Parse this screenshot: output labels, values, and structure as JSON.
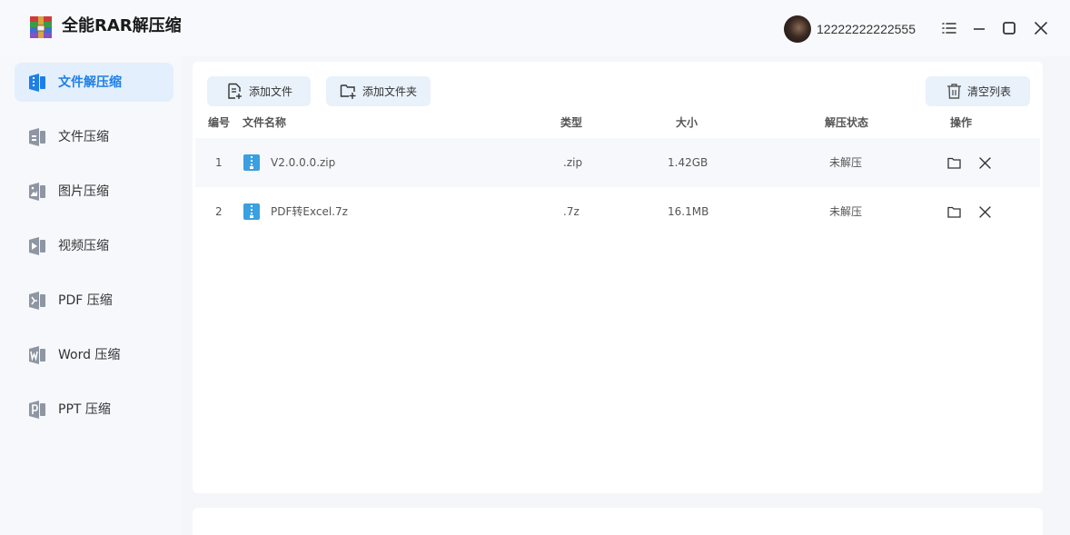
{
  "app": {
    "title": "全能RAR解压缩"
  },
  "user": {
    "name": "12222222222555"
  },
  "sidebar": {
    "items": [
      {
        "label": "文件解压缩",
        "icon": "unzip-file-icon",
        "active": true
      },
      {
        "label": "文件压缩",
        "icon": "compress-file-icon",
        "active": false
      },
      {
        "label": "图片压缩",
        "icon": "image-icon",
        "active": false
      },
      {
        "label": "视频压缩",
        "icon": "video-icon",
        "active": false
      },
      {
        "label": "PDF 压缩",
        "icon": "pdf-icon",
        "active": false
      },
      {
        "label": "Word 压缩",
        "icon": "word-icon",
        "active": false
      },
      {
        "label": "PPT 压缩",
        "icon": "ppt-icon",
        "active": false
      }
    ]
  },
  "toolbar": {
    "add_file": "添加文件",
    "add_folder": "添加文件夹",
    "clear_list": "清空列表"
  },
  "table": {
    "headers": {
      "num": "编号",
      "name": "文件名称",
      "type": "类型",
      "size": "大小",
      "status": "解压状态",
      "action": "操作"
    },
    "rows": [
      {
        "num": "1",
        "name": "V2.0.0.0.zip",
        "type": ".zip",
        "size": "1.42GB",
        "status": "未解压"
      },
      {
        "num": "2",
        "name": "PDF转Excel.7z",
        "type": ".7z",
        "size": "16.1MB",
        "status": "未解压"
      }
    ]
  },
  "colors": {
    "accent": "#1e7fe6",
    "active_bg": "#e3effc",
    "button_bg": "#e9f1fb",
    "archive_icon": "#3aa0e0"
  }
}
